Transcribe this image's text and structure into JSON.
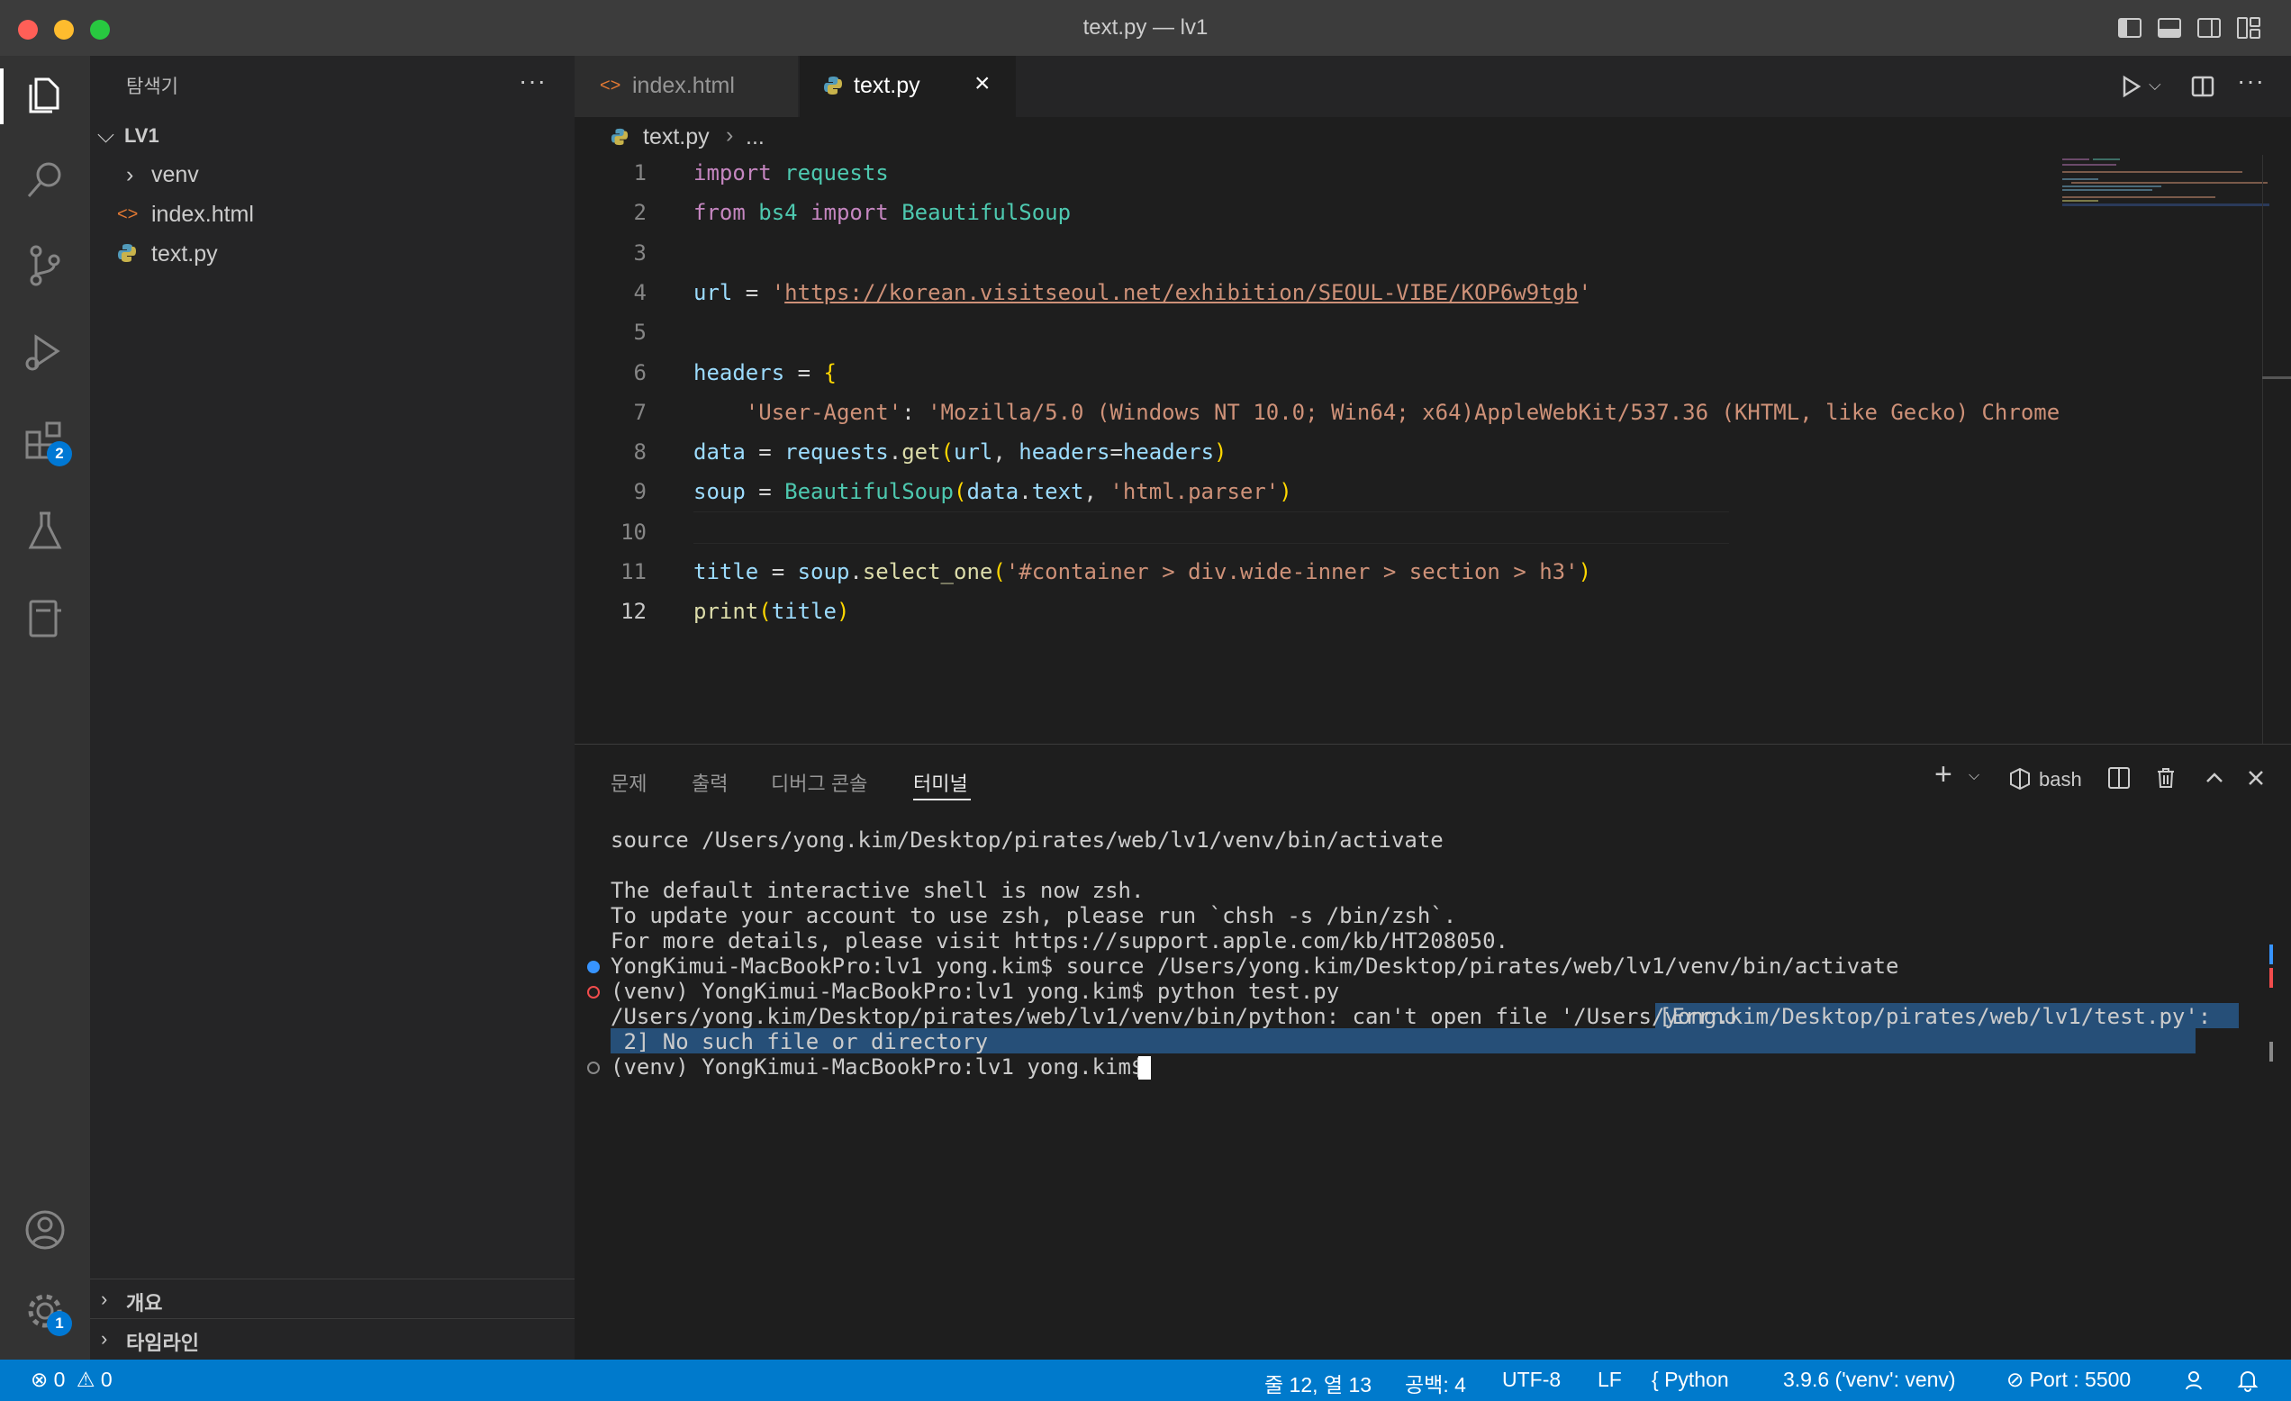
{
  "window": {
    "title": "text.py — lv1"
  },
  "sidebar": {
    "header": "탐색기",
    "more": "···",
    "root": "LV1",
    "items": [
      {
        "label": "venv",
        "type": "folder"
      },
      {
        "label": "index.html",
        "type": "html"
      },
      {
        "label": "text.py",
        "type": "python"
      }
    ],
    "sections": [
      "개요",
      "타임라인"
    ]
  },
  "tabs": [
    {
      "label": "index.html",
      "active": false
    },
    {
      "label": "text.py",
      "active": true
    }
  ],
  "breadcrumb": {
    "file": "text.py",
    "rest": "..."
  },
  "editor": {
    "active_line": 12,
    "line_numbers": [
      "1",
      "2",
      "3",
      "4",
      "5",
      "6",
      "7",
      "8",
      "9",
      "10",
      "11",
      "12"
    ],
    "lines": [
      {
        "parts": [
          [
            "kw",
            "import"
          ],
          [
            "pun",
            " "
          ],
          [
            "mod",
            "requests"
          ]
        ]
      },
      {
        "parts": [
          [
            "kw",
            "from"
          ],
          [
            "pun",
            " "
          ],
          [
            "mod",
            "bs4"
          ],
          [
            "pun",
            " "
          ],
          [
            "kw",
            "import"
          ],
          [
            "pun",
            " "
          ],
          [
            "mod",
            "BeautifulSoup"
          ]
        ]
      },
      {
        "parts": []
      },
      {
        "parts": [
          [
            "var",
            "url"
          ],
          [
            "pun",
            " = "
          ],
          [
            "str",
            "'"
          ],
          [
            "strlink",
            "https://korean.visitseoul.net/exhibition/SEOUL-VIBE/KOP6w9tgb"
          ],
          [
            "str",
            "'"
          ]
        ]
      },
      {
        "parts": []
      },
      {
        "parts": [
          [
            "var",
            "headers"
          ],
          [
            "pun",
            " = "
          ],
          [
            "brk",
            "{"
          ]
        ]
      },
      {
        "parts": [
          [
            "pun",
            "    "
          ],
          [
            "str",
            "'User-Agent'"
          ],
          [
            "pun",
            ": "
          ],
          [
            "str",
            "'Mozilla/5.0 (Windows NT 10.0; Win64; x64)AppleWebKit/537.36 (KHTML, like Gecko) Chrome"
          ]
        ]
      },
      {
        "parts": [
          [
            "var",
            "data"
          ],
          [
            "pun",
            " = "
          ],
          [
            "var",
            "requests"
          ],
          [
            "pun",
            "."
          ],
          [
            "fn",
            "get"
          ],
          [
            "brk",
            "("
          ],
          [
            "var",
            "url"
          ],
          [
            "pun",
            ", "
          ],
          [
            "var",
            "headers"
          ],
          [
            "pun",
            "="
          ],
          [
            "var",
            "headers"
          ],
          [
            "brk",
            ")"
          ]
        ]
      },
      {
        "parts": [
          [
            "var",
            "soup"
          ],
          [
            "pun",
            " = "
          ],
          [
            "mod",
            "BeautifulSoup"
          ],
          [
            "brk",
            "("
          ],
          [
            "var",
            "data"
          ],
          [
            "pun",
            "."
          ],
          [
            "var",
            "text"
          ],
          [
            "pun",
            ", "
          ],
          [
            "str",
            "'html.parser'"
          ],
          [
            "brk",
            ")"
          ]
        ]
      },
      {
        "parts": []
      },
      {
        "parts": [
          [
            "var",
            "title"
          ],
          [
            "pun",
            " = "
          ],
          [
            "var",
            "soup"
          ],
          [
            "pun",
            "."
          ],
          [
            "fn",
            "select_one"
          ],
          [
            "brk",
            "("
          ],
          [
            "str",
            "'#container > div.wide-inner > section > h3'"
          ],
          [
            "brk",
            ")"
          ]
        ]
      },
      {
        "parts": [
          [
            "fn",
            "print"
          ],
          [
            "brk",
            "("
          ],
          [
            "var",
            "title"
          ],
          [
            "brk",
            ")"
          ]
        ]
      }
    ]
  },
  "panel": {
    "tabs": [
      "문제",
      "출력",
      "디버그 콘솔",
      "터미널"
    ],
    "active_tab": "터미널",
    "shell": "bash",
    "terminal_lines": [
      "source /Users/yong.kim/Desktop/pirates/web/lv1/venv/bin/activate",
      "",
      "The default interactive shell is now zsh.",
      "To update your account to use zsh, please run `chsh -s /bin/zsh`.",
      "For more details, please visit https://support.apple.com/kb/HT208050.",
      "YongKimui-MacBookPro:lv1 yong.kim$ source /Users/yong.kim/Desktop/pirates/web/lv1/venv/bin/activate",
      "(venv) YongKimui-MacBookPro:lv1 yong.kim$ python test.py",
      "/Users/yong.kim/Desktop/pirates/web/lv1/venv/bin/python: can't open file '/Users/yong.kim/Desktop/pirates/web/lv1/test.py': ",
      " 2] No such file or directory",
      "(venv) YongKimui-MacBookPro:lv1 yong.kim$ "
    ],
    "errno_highlight": "[Errno"
  },
  "statusbar": {
    "errors": "0",
    "warnings": "0",
    "position": "줄 12, 열 13",
    "spaces": "공백: 4",
    "encoding": "UTF-8",
    "eol": "LF",
    "language": "Python",
    "interpreter": "3.9.6 ('venv': venv)",
    "port": "Port : 5500"
  },
  "badges": {
    "extensions": "2",
    "settings": "1"
  },
  "colors": {
    "accent": "#007acc",
    "background": "#1e1e1e",
    "sidebar": "#252526"
  }
}
